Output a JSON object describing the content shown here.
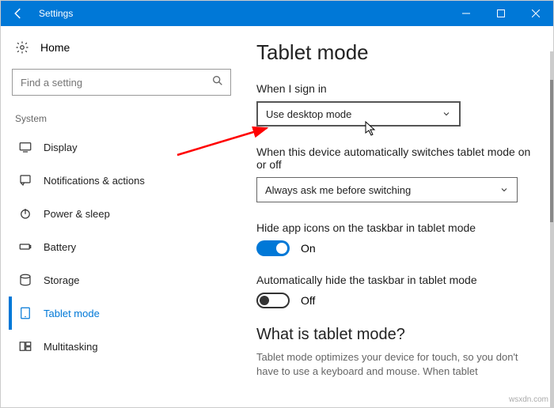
{
  "titlebar": {
    "title": "Settings"
  },
  "sidebar": {
    "home_label": "Home",
    "search_placeholder": "Find a setting",
    "section_label": "System",
    "items": [
      {
        "label": "Display"
      },
      {
        "label": "Notifications & actions"
      },
      {
        "label": "Power & sleep"
      },
      {
        "label": "Battery"
      },
      {
        "label": "Storage"
      },
      {
        "label": "Tablet mode"
      },
      {
        "label": "Multitasking"
      }
    ]
  },
  "main": {
    "page_title": "Tablet mode",
    "signin_label": "When I sign in",
    "signin_value": "Use desktop mode",
    "switch_label": "When this device automatically switches tablet mode on or off",
    "switch_value": "Always ask me before switching",
    "hide_icons_label": "Hide app icons on the taskbar in tablet mode",
    "hide_icons_state": "On",
    "hide_taskbar_label": "Automatically hide the taskbar in tablet mode",
    "hide_taskbar_state": "Off",
    "what_heading": "What is tablet mode?",
    "what_desc": "Tablet mode optimizes your device for touch, so you don't have to use a keyboard and mouse. When tablet"
  },
  "watermark": "wsxdn.com"
}
